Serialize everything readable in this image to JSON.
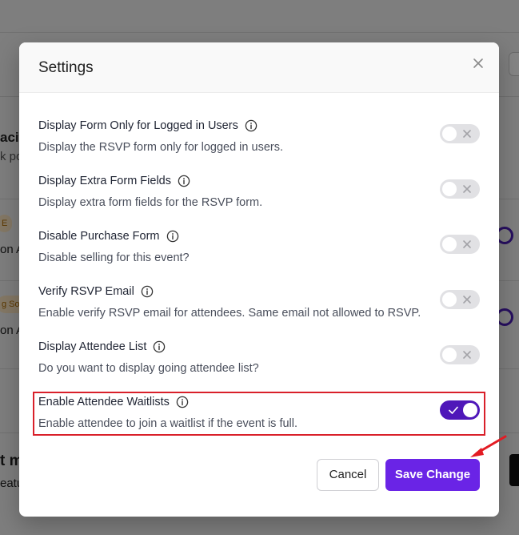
{
  "background": {
    "left_texts": [
      "acit",
      "k po",
      "E",
      "on A",
      "g Soc",
      "on A",
      "t m",
      "eatu"
    ]
  },
  "modal": {
    "title": "Settings",
    "close_label": "×",
    "settings": [
      {
        "title": "Display Form Only for Logged in Users",
        "description": "Display the RSVP form only for logged in users.",
        "enabled": false
      },
      {
        "title": "Display Extra Form Fields",
        "description": "Display extra form fields for the RSVP form.",
        "enabled": false
      },
      {
        "title": "Disable Purchase Form",
        "description": "Disable selling for this event?",
        "enabled": false
      },
      {
        "title": "Verify RSVP Email",
        "description": "Enable verify RSVP email for attendees. Same email not allowed to RSVP.",
        "enabled": false
      },
      {
        "title": "Display Attendee List",
        "description": "Do you want to display going attendee list?",
        "enabled": false
      },
      {
        "title": "Enable Attendee Waitlists",
        "description": "Enable attendee to join a waitlist if the event is full.",
        "enabled": true
      }
    ],
    "buttons": {
      "cancel": "Cancel",
      "save": "Save Change"
    }
  },
  "colors": {
    "accent": "#6a24e6",
    "toggle_on": "#4f17b9",
    "highlight": "#d9202a"
  }
}
